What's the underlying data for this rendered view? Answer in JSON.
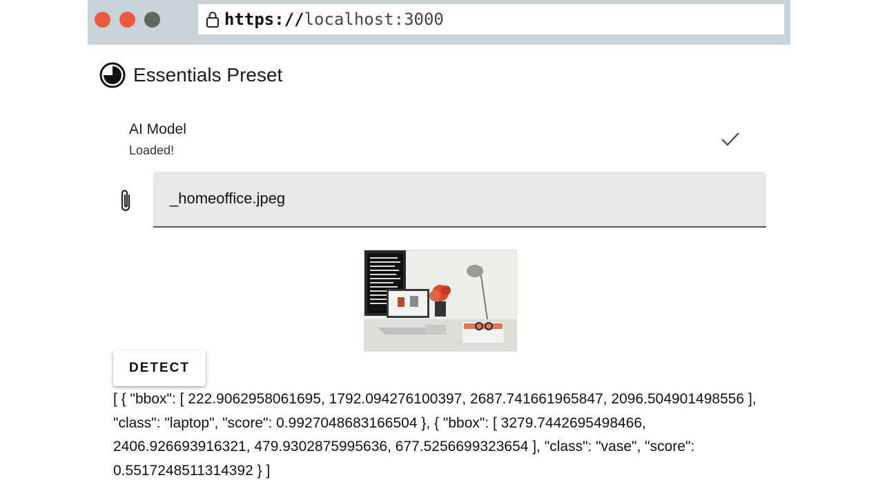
{
  "browser": {
    "url_scheme": "https://",
    "url_host": "localhost:3000"
  },
  "app": {
    "title": "Essentials Preset"
  },
  "model": {
    "title": "AI Model",
    "status": "Loaded!"
  },
  "file_input": {
    "value": "_homeoffice.jpeg"
  },
  "detect_button": {
    "label": "DETECT"
  },
  "result": {
    "text": "[ { \"bbox\": [ 222.9062958061695, 1792.094276100397, 2687.741661965847, 2096.504901498556 ], \"class\": \"laptop\", \"score\": 0.9927048683166504 }, { \"bbox\": [ 3279.7442695498466, 2406.926693916321, 479.9302875995636, 677.5256699323654 ], \"class\": \"vase\", \"score\": 0.5517248511314392 } ]"
  },
  "colors": {
    "window_close": "#ec5a40",
    "window_minimize": "#ec5a40",
    "window_maximize": "#5e685c",
    "browser_bar": "#c9d2d6",
    "field_background": "#e8e8e8"
  }
}
